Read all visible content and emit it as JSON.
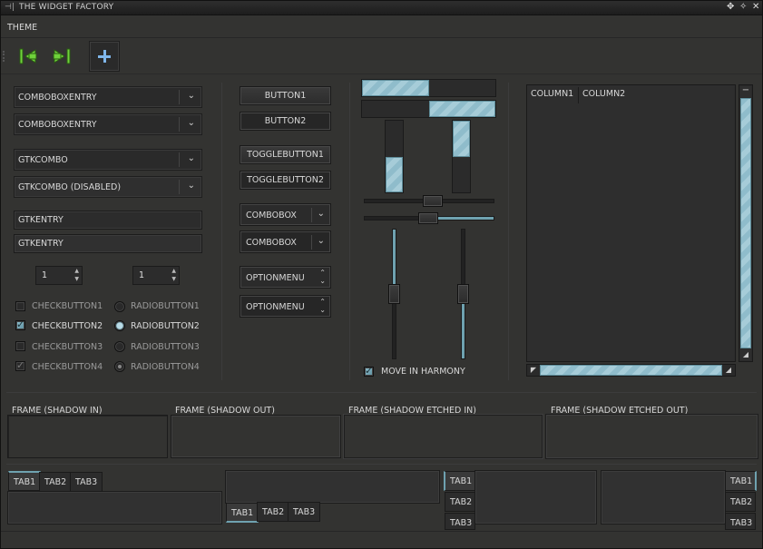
{
  "window": {
    "title": "THE WIDGET FACTORY"
  },
  "menubar": {
    "theme_label": "THEME"
  },
  "toolbar": {
    "back_icon": "go-first-icon",
    "forward_icon": "go-last-icon",
    "add_icon": "plus-icon"
  },
  "comboentries": [
    {
      "label": "COMBOBOXENTRY"
    },
    {
      "label": "COMBOBOXENTRY"
    }
  ],
  "gtkcombos": [
    {
      "label": "GTKCOMBO"
    },
    {
      "label": "GTKCOMBO (DISABLED)"
    }
  ],
  "entries": [
    {
      "value": "GTKENTRY"
    },
    {
      "value": "GTKENTRY"
    }
  ],
  "spins": [
    {
      "value": "1"
    },
    {
      "value": "1"
    }
  ],
  "checkbuttons": [
    {
      "label": "CHECKBUTTON1",
      "checked": false
    },
    {
      "label": "CHECKBUTTON2",
      "checked": true
    },
    {
      "label": "CHECKBUTTON3",
      "checked": false
    },
    {
      "label": "CHECKBUTTON4",
      "checked": true
    }
  ],
  "radiobuttons": [
    {
      "label": "RADIOBUTTON1",
      "checked": false
    },
    {
      "label": "RADIOBUTTON2",
      "checked": true
    },
    {
      "label": "RADIOBUTTON3",
      "checked": false
    },
    {
      "label": "RADIOBUTTON4",
      "checked": true
    }
  ],
  "buttons": {
    "button1": "BUTTON1",
    "button2": "BUTTON2",
    "toggle1": "TOGGLEBUTTON1",
    "toggle2": "TOGGLEBUTTON2",
    "combobox1": "COMBOBOX",
    "combobox2": "COMBOBOX",
    "optionmenu1": "OPTIONMENU",
    "optionmenu2": "OPTIONMENU"
  },
  "progress": {
    "horizontal_1": 0.5,
    "horizontal_2": 0.5,
    "vertical_1": 0.5,
    "vertical_2": 0.5
  },
  "scales": {
    "horizontal_1": 0.5,
    "horizontal_2": 0.5,
    "vertical_1": 0.5,
    "vertical_2": 0.5
  },
  "harmony": {
    "label": "MOVE IN HARMONY",
    "checked": true
  },
  "tree": {
    "columns": [
      "COLUMN1",
      "COLUMN2"
    ]
  },
  "frames": [
    {
      "label": "FRAME (SHADOW IN)"
    },
    {
      "label": "FRAME (SHADOW OUT)"
    },
    {
      "label": "FRAME (SHADOW ETCHED IN)"
    },
    {
      "label": "FRAME (SHADOW ETCHED OUT)"
    }
  ],
  "notebooks": [
    {
      "tabs": [
        "TAB1",
        "TAB2",
        "TAB3"
      ]
    },
    {
      "tabs": [
        "TAB1",
        "TAB2",
        "TAB3"
      ]
    },
    {
      "tabs": [
        "TAB1",
        "TAB2",
        "TAB3"
      ]
    },
    {
      "tabs": [
        "TAB1",
        "TAB2",
        "TAB3"
      ]
    }
  ],
  "colors": {
    "accent": "#6fa2b0",
    "background": "#333331",
    "toolbar_icon": "#6fd23b"
  }
}
